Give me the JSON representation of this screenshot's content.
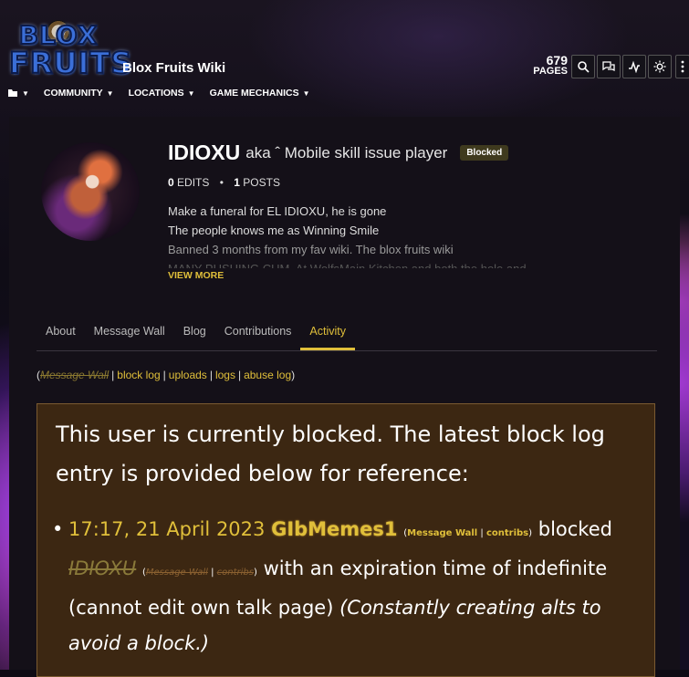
{
  "header": {
    "logo_line1": "BLOX",
    "logo_line2": "FRUITS",
    "site_name": "Blox Fruits Wiki",
    "pages_count": "679",
    "pages_label": "PAGES",
    "tools": [
      "search-icon",
      "discussions-icon",
      "activity-icon",
      "theme-icon",
      "more-icon"
    ]
  },
  "nav": {
    "items": [
      {
        "label": "COMMUNITY"
      },
      {
        "label": "LOCATIONS"
      },
      {
        "label": "GAME MECHANICS"
      }
    ]
  },
  "profile": {
    "username": "IDIOXU",
    "aka": "aka ˆ Mobile skill issue player",
    "badge": "Blocked",
    "edits_count": "0",
    "edits_label": "EDITS",
    "posts_count": "1",
    "posts_label": "POSTS",
    "bio": [
      "Make a funeral for EL IDIOXU, he is gone",
      "The people knows me as Winning Smile",
      "Banned 3 months from my fav wiki.  The blox fruits wiki",
      "MANY PUSHING CUM. At WolfsMain Kitchen and both the hole and"
    ],
    "view_more": "VIEW MORE"
  },
  "tabs": [
    {
      "label": "About"
    },
    {
      "label": "Message Wall"
    },
    {
      "label": "Blog"
    },
    {
      "label": "Contributions"
    },
    {
      "label": "Activity",
      "active": true
    }
  ],
  "links": {
    "message_wall": "Message Wall",
    "block_log": "block log",
    "uploads": "uploads",
    "logs": "logs",
    "abuse_log": "abuse log"
  },
  "notice": {
    "text": "This user is currently blocked. The latest block log entry is provided below for reference:",
    "timestamp": "17:17, 21 April 2023",
    "admin": "GIbMemes1",
    "admin_wall": "Message Wall",
    "admin_contribs": "contribs",
    "blocked_word": "blocked",
    "target": "IDIOXU",
    "target_wall": "Message Wall",
    "target_contribs": "contribs",
    "expiry_text": "with an expiration time of indefinite (cannot edit own talk page)",
    "reason": "(Constantly creating alts to avoid a block.)"
  },
  "colors": {
    "accent": "#e0bf3a",
    "notice_bg": "#3c2712",
    "badge_bg": "#3f3a1e"
  }
}
